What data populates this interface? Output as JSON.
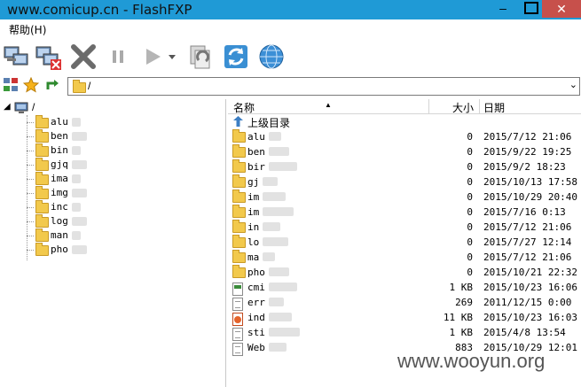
{
  "window": {
    "title": "www.comicup.cn - FlashFXP",
    "minimize": "–",
    "close": "✕"
  },
  "menu": {
    "help": "帮助(H)"
  },
  "toolbar": {
    "icons": [
      "connect-icon",
      "disconnect-icon",
      "abort-icon",
      "pause-icon",
      "play-icon",
      "refresh-local-icon",
      "refresh-icon",
      "globe-icon"
    ]
  },
  "address": {
    "path": "/"
  },
  "tree": {
    "root_label": "/",
    "items": [
      {
        "label": "alu"
      },
      {
        "label": "ben"
      },
      {
        "label": "bin"
      },
      {
        "label": "gjq"
      },
      {
        "label": "ima"
      },
      {
        "label": "img"
      },
      {
        "label": "inc"
      },
      {
        "label": "log"
      },
      {
        "label": "man"
      },
      {
        "label": "pho"
      }
    ]
  },
  "list": {
    "columns": {
      "name": "名称",
      "size": "大小",
      "date": "日期"
    },
    "parent_label": "上级目录",
    "rows": [
      {
        "name": "alu",
        "size": "0",
        "date": "2015/7/12 21:06",
        "type": "folder"
      },
      {
        "name": "ben",
        "size": "0",
        "date": "2015/9/22 19:25",
        "type": "folder"
      },
      {
        "name": "bir",
        "size": "0",
        "date": "2015/9/2 18:23",
        "type": "folder"
      },
      {
        "name": "gj",
        "size": "0",
        "date": "2015/10/13 17:58",
        "type": "folder"
      },
      {
        "name": "im",
        "size": "0",
        "date": "2015/10/29 20:40",
        "type": "folder"
      },
      {
        "name": "im",
        "size": "0",
        "date": "2015/7/16 0:13",
        "type": "folder"
      },
      {
        "name": "in",
        "size": "0",
        "date": "2015/7/12 21:06",
        "type": "folder"
      },
      {
        "name": "lo",
        "size": "0",
        "date": "2015/7/27 12:14",
        "type": "folder"
      },
      {
        "name": "ma",
        "size": "0",
        "date": "2015/7/12 21:06",
        "type": "folder"
      },
      {
        "name": "pho",
        "size": "0",
        "date": "2015/10/21 22:32",
        "type": "folder"
      },
      {
        "name": "cmi",
        "size": "1 KB",
        "date": "2015/10/23 16:06",
        "type": "cmd"
      },
      {
        "name": "err",
        "size": "269",
        "date": "2011/12/15 0:00",
        "type": "txt"
      },
      {
        "name": "ind",
        "size": "11 KB",
        "date": "2015/10/23 16:03",
        "type": "html"
      },
      {
        "name": "sti",
        "size": "1 KB",
        "date": "2015/4/8 13:54",
        "type": "txt"
      },
      {
        "name": "Web",
        "size": "883",
        "date": "2015/10/29 12:01",
        "type": "txt"
      }
    ]
  },
  "watermark": "www.wooyun.org"
}
